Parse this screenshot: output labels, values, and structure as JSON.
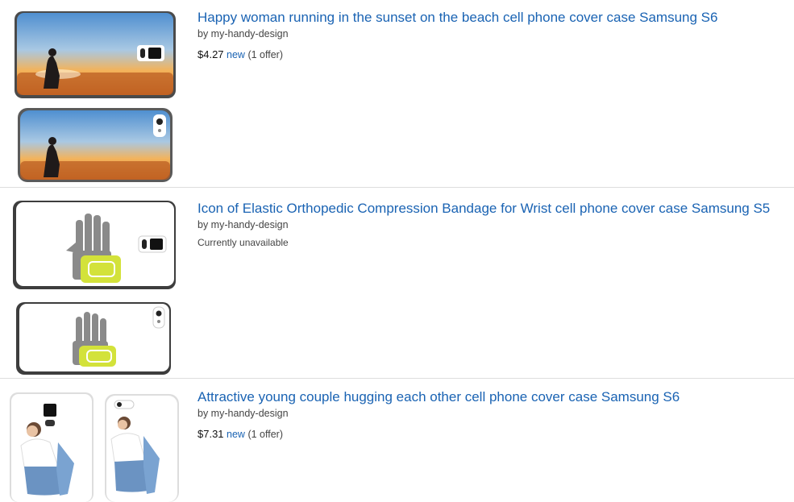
{
  "results": [
    {
      "title": "Happy woman running in the sunset on the beach cell phone cover case Samsung S6",
      "byline": "by my-handy-design",
      "price": "$4.27",
      "condition": "new",
      "offers": "(1 offer)",
      "image": "beach-sunset-phone-cases"
    },
    {
      "title": "Icon of Elastic Orthopedic Compression Bandage for Wrist cell phone cover case Samsung S5",
      "byline": "by my-handy-design",
      "status": "Currently unavailable",
      "image": "wrist-bandage-phone-cases"
    },
    {
      "title": "Attractive young couple hugging each other cell phone cover case Samsung S6",
      "byline": "by my-handy-design",
      "price": "$7.31",
      "condition": "new",
      "offers": "(1 offer)",
      "image": "hugging-couple-phone-cases"
    }
  ],
  "colors": {
    "link": "#1a63b3",
    "text": "#111111",
    "muted": "#444444",
    "divider": "#dddddd"
  }
}
